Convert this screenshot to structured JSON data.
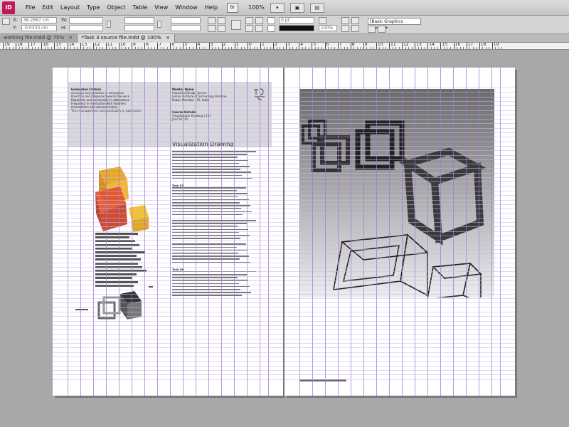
{
  "app": {
    "logo_text": "ID",
    "menus": [
      "File",
      "Edit",
      "Layout",
      "Type",
      "Object",
      "Table",
      "View",
      "Window",
      "Help"
    ],
    "bridge_label": "Br",
    "zoom": "100%"
  },
  "control_panel": {
    "x_label": "X:",
    "x_value": "46.2867 cm",
    "y_label": "Y:",
    "y_value": "-0.0333 cm",
    "w_label": "W:",
    "h_label": "H:",
    "stroke_weight": "0 pt",
    "opacity": "100%",
    "object_style": "[Basic Graphics Frame]+"
  },
  "tabs": [
    {
      "label": "working file.indd @ 75%",
      "active": false
    },
    {
      "label": "*Task 3 source file.indd @ 100%",
      "active": true
    }
  ],
  "tab_close_glyph": "×",
  "ruler": {
    "labels": [
      "19",
      "18",
      "17",
      "16",
      "15",
      "14",
      "13",
      "12",
      "11",
      "10",
      "9",
      "8",
      "7",
      "6",
      "5",
      "4",
      "3",
      "2",
      "1",
      "0",
      "1",
      "2",
      "3",
      "4",
      "5",
      "6",
      "7",
      "8",
      "9",
      "10",
      "11",
      "12",
      "13",
      "14",
      "15",
      "16",
      "17",
      "18",
      "19"
    ]
  },
  "document": {
    "criteria_left": [
      "Evaluation Criteria",
      "Accuracy and precision in executions",
      "Direction and diligence towards the work",
      "Regularity and punctuality in attendance",
      "Frequency in interaction with teachers",
      "Presentation and documentation",
      "Time management and punctuality in submission"
    ],
    "criteria_right": [
      "Mentor Name",
      "Industrial Design Centre",
      "Indian Institute of Technology Bombay",
      "Powai, Mumbai - 76, India",
      "",
      "Course Details",
      "Visualization Drawing | 101",
      "Jan/Feb '10"
    ],
    "title": "Visualization Drawing",
    "task_headings": [
      "Task 07:",
      "Task 08:"
    ]
  }
}
